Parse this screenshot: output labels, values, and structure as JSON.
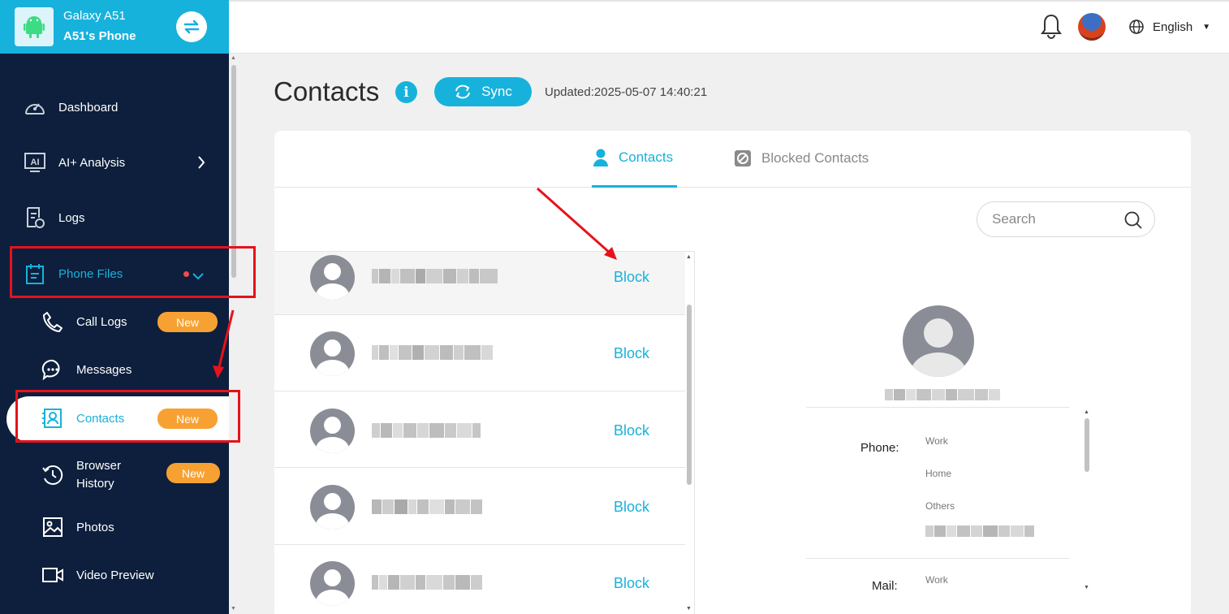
{
  "device": {
    "model": "Galaxy A51",
    "name": "A51's Phone"
  },
  "topbar": {
    "language": "English"
  },
  "sidebar": {
    "items": [
      {
        "label": "Dashboard"
      },
      {
        "label": "AI+ Analysis"
      },
      {
        "label": "Logs"
      },
      {
        "label": "Phone Files"
      },
      {
        "label": "Call Logs",
        "badge": "New"
      },
      {
        "label": "Messages"
      },
      {
        "label": "Contacts",
        "badge": "New"
      },
      {
        "label": "Browser History",
        "badge": "New"
      },
      {
        "label": "Photos"
      },
      {
        "label": "Video Preview"
      }
    ]
  },
  "ai_icon_text": "AI",
  "page": {
    "title": "Contacts",
    "info": "i",
    "sync_label": "Sync",
    "updated": "Updated:2025-05-07 14:40:21"
  },
  "tabs": [
    {
      "label": "Contacts"
    },
    {
      "label": "Blocked Contacts"
    }
  ],
  "search": {
    "placeholder": "Search"
  },
  "contact_action": "Block",
  "detail": {
    "phone_label": "Phone:",
    "phone_types": [
      "Work",
      "Home",
      "Others"
    ],
    "mail_label": "Mail:",
    "mail_types": [
      "Work"
    ]
  },
  "colors": {
    "accent": "#17b2dc",
    "sidebar": "#0d1f3c",
    "badge": "#f7a133",
    "annotation": "#e6121c"
  },
  "icons": [
    "android-icon",
    "switch-device-icon",
    "bell-icon",
    "globe-icon",
    "dashboard-icon",
    "ai-icon",
    "logs-icon",
    "phone-files-icon",
    "call-logs-icon",
    "messages-icon",
    "contacts-icon",
    "browser-history-icon",
    "photos-icon",
    "video-icon",
    "info-icon",
    "sync-icon",
    "person-icon",
    "blocked-icon",
    "search-icon"
  ]
}
